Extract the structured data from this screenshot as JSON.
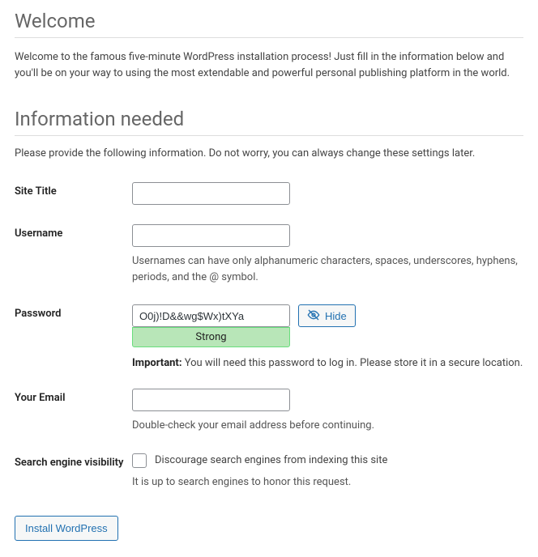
{
  "headings": {
    "welcome": "Welcome",
    "info_needed": "Information needed"
  },
  "intro_text": "Welcome to the famous five-minute WordPress installation process! Just fill in the information below and you'll be on your way to using the most extendable and powerful personal publishing platform in the world.",
  "info_needed_text": "Please provide the following information. Do not worry, you can always change these settings later.",
  "fields": {
    "site_title": {
      "label": "Site Title",
      "value": ""
    },
    "username": {
      "label": "Username",
      "value": "",
      "description": "Usernames can have only alphanumeric characters, spaces, underscores, hyphens, periods, and the @ symbol."
    },
    "password": {
      "label": "Password",
      "value": "O0j)!D&&wg$Wx)tXYa",
      "strength": "Strong",
      "hide_label": "Hide",
      "important_label": "Important:",
      "important_text": " You will need this password to log in. Please store it in a secure location."
    },
    "email": {
      "label": "Your Email",
      "value": "",
      "description": "Double-check your email address before continuing."
    },
    "search_visibility": {
      "label": "Search engine visibility",
      "checkbox_label": "Discourage search engines from indexing this site",
      "description": "It is up to search engines to honor this request."
    }
  },
  "submit": {
    "label": "Install WordPress"
  }
}
